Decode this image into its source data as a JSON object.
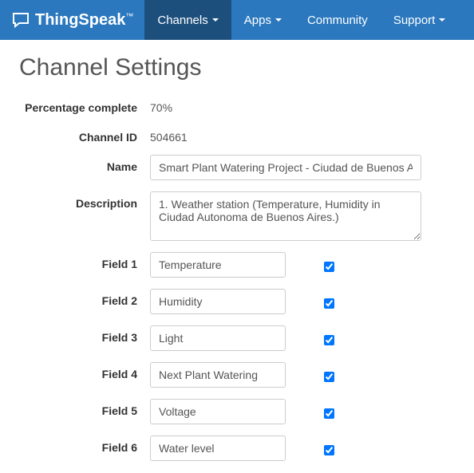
{
  "brand": "ThingSpeak",
  "nav": {
    "channels": "Channels",
    "apps": "Apps",
    "community": "Community",
    "support": "Support"
  },
  "title": "Channel Settings",
  "rows": {
    "percent_label": "Percentage complete",
    "percent_value": "70%",
    "channel_id_label": "Channel ID",
    "channel_id_value": "504661",
    "name_label": "Name",
    "name_value": "Smart Plant Watering Project - Ciudad de Buenos Aires",
    "desc_label": "Description",
    "desc_value": "1. Weather station (Temperature, Humidity in Ciudad Autonoma de Buenos Aires.)"
  },
  "fields": [
    {
      "label": "Field 1",
      "value": "Temperature",
      "checked": true
    },
    {
      "label": "Field 2",
      "value": "Humidity",
      "checked": true
    },
    {
      "label": "Field 3",
      "value": "Light",
      "checked": true
    },
    {
      "label": "Field 4",
      "value": "Next Plant Watering",
      "checked": true
    },
    {
      "label": "Field 5",
      "value": "Voltage",
      "checked": true
    },
    {
      "label": "Field 6",
      "value": "Water level",
      "checked": true
    }
  ]
}
